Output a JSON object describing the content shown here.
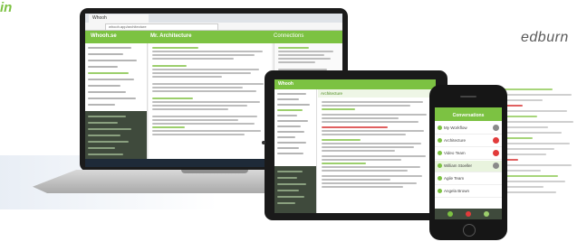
{
  "branding": {
    "left_fragment": "in",
    "right_fragment": "edburn"
  },
  "laptop": {
    "browser_tab": "Whooh",
    "url": "whooh.app/architecture",
    "app_name": "Whooh.se",
    "topic_title": "Mr. Architecture",
    "connections_title": "Connections"
  },
  "tablet": {
    "app_name": "Whooh",
    "main_header": "Architecture"
  },
  "phone": {
    "title": "Conversations",
    "items": [
      {
        "label": "My Workflow",
        "badge_color": "#8a8a8a"
      },
      {
        "label": "Architecture",
        "badge_color": "#e23b3b"
      },
      {
        "label": "Video Team",
        "badge_color": "#e23b3b"
      },
      {
        "label": "William Stoeller",
        "badge_color": "#8a8a8a"
      },
      {
        "label": "Agile Team",
        "badge_color": "#8a8a8a"
      },
      {
        "label": "Angela Brown",
        "badge_color": "#8a8a8a"
      }
    ]
  },
  "colors": {
    "accent": "#7cc242",
    "sidebar_dark": "#3f4a3c",
    "alert": "#e23b3b"
  }
}
